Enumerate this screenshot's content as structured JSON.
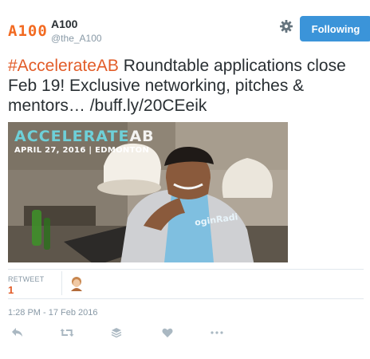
{
  "account": {
    "logo_text": "A100",
    "name": "A100",
    "handle": "@the_A100"
  },
  "follow_button": {
    "label": "Following"
  },
  "settings_icon": "gear-icon",
  "tweet": {
    "hashtag": "#AccelerateAB",
    "text_main": " Roundtable applications close Feb 19! Exclusive networking, pitches & mentors… ",
    "link": "/buff.ly/20CEeik"
  },
  "media": {
    "promo_title_main": "ACCELERATE",
    "promo_title_suffix": "AB",
    "promo_date": "APRIL 27, 2016 | EDMONTON",
    "shirt_text": "oginRadi"
  },
  "stats": {
    "retweet_label": "RETWEET",
    "retweet_count": "1"
  },
  "timestamp": "1:28 PM - 17 Feb 2016",
  "actions": [
    "reply-icon",
    "retweet-icon",
    "stack-icon",
    "heart-icon",
    "more-icon"
  ],
  "colors": {
    "accent": "#e25c28",
    "follow_button": "#3b94d9",
    "logo": "#f26a21",
    "muted": "#8899a6"
  }
}
